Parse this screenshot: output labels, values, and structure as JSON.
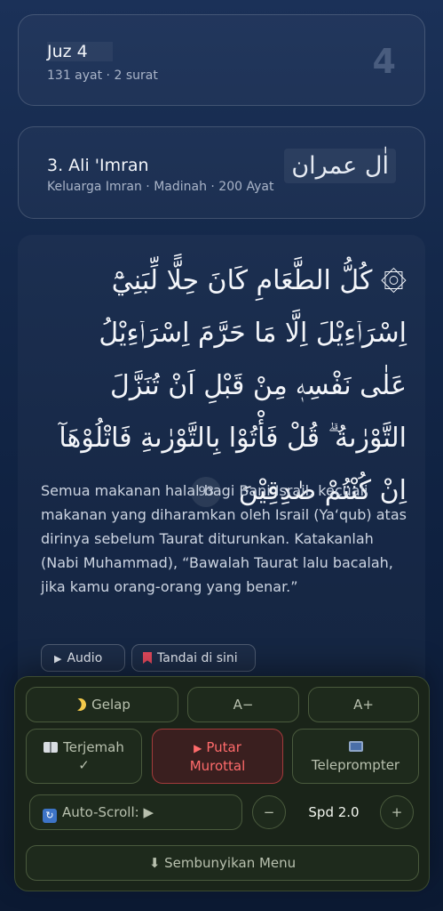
{
  "juz": {
    "title": "Juz 4",
    "subtitle": "131 ayat · 2 surat",
    "number": "4"
  },
  "surah": {
    "title": "3. Ali 'Imran",
    "subtitle": "Keluarga Imran · Madinah · 200 Ayat",
    "arabic_name": "اٰل عمران"
  },
  "ayah": {
    "arabic": "۞ كُلُّ الطَّعَامِ كَانَ حِلًّا لِّبَنِيْٓ اِسْرَاۤءِيْلَ اِلَّا مَا حَرَّمَ اِسْرَاۤءِيْلُ عَلٰى نَفْسِهٖ مِنْ قَبْلِ اَنْ تُنَزَّلَ التَّوْرٰىةُ ۗ قُلْ فَأْتُوْا بِالتَّوْرٰىةِ فَاتْلُوْهَآ اِنْ كُنْتُمْ صٰدِقِيْنَ",
    "number": "93",
    "translation": "Semua makanan halal bagi Bani Israil, kecuali makanan yang diharamkan oleh Israil (Ya‘qub) atas dirinya sebelum Taurat diturunkan. Katakanlah (Nabi Muhammad), “Bawalah Taurat lalu bacalah, jika kamu orang-orang yang benar.”",
    "audio_label": "Audio",
    "bookmark_label": "Tandai di sini"
  },
  "controls": {
    "dark_label": "Gelap",
    "font_decrease": "A−",
    "font_increase": "A+",
    "translation_label": "Terjemah",
    "translation_check": "✓",
    "murottal_line1": "Putar",
    "murottal_line2": "Murottal",
    "teleprompter_label": "Teleprompter",
    "autoscroll_label": "Auto-Scroll: ▶",
    "speed_minus": "−",
    "speed_label": "Spd 2.0",
    "speed_plus": "+",
    "hide_menu_label": "⬇ Sembunyikan Menu"
  },
  "colors": {
    "accent_red": "#ff6b6b",
    "panel_bg": "#1a2419",
    "bookmark_red": "#e0485b"
  },
  "icons": {
    "dark": "moon-icon",
    "translation": "book-icon",
    "murottal": "play-icon",
    "teleprompter": "tv-icon",
    "autoscroll": "refresh-icon",
    "audio": "play-icon",
    "bookmark": "bookmark-icon"
  }
}
